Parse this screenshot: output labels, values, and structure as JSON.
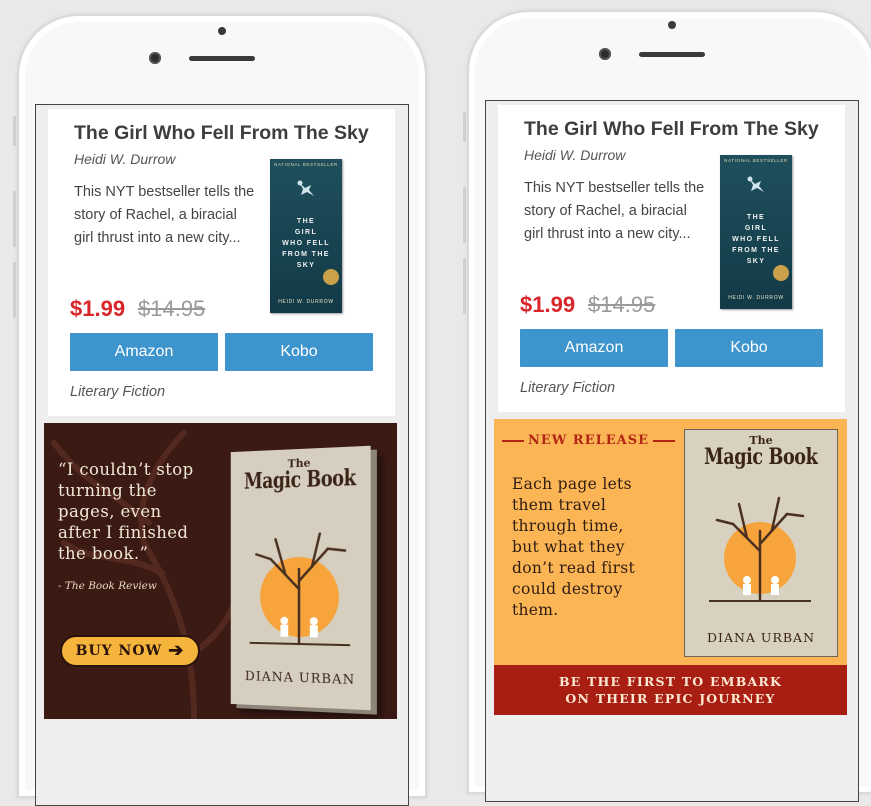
{
  "book": {
    "title": "The Girl Who Fell From The Sky",
    "author": "Heidi W. Durrow",
    "blurb": "This NYT bestseller tells the story of Rachel, a biracial girl thrust into a new city...",
    "sale_price": "$1.99",
    "original_price": "$14.95",
    "buttons": {
      "amazon": "Amazon",
      "kobo": "Kobo"
    },
    "genre": "Literary Fiction",
    "cover": {
      "badge": "NATIONAL BESTSELLER",
      "title_lines": [
        "THE",
        "GIRL",
        "WHO FELL",
        "FROM THE",
        "SKY"
      ],
      "author": "HEIDI W. DURROW"
    }
  },
  "ad_left": {
    "quote_lines": [
      "“I couldn’t stop",
      "turning the",
      "pages, even",
      "after I finished",
      "the book.”"
    ],
    "source": "- The Book Review",
    "buy_label": "BUY NOW",
    "book": {
      "the": "The",
      "name": "Magic Book",
      "author": "DIANA URBAN"
    }
  },
  "ad_right": {
    "tag": "NEW RELEASE",
    "desc_lines": [
      "Each page lets",
      "them travel",
      "through time,",
      "but what they",
      "don’t read first",
      "could destroy",
      "them."
    ],
    "banner_lines": [
      "BE THE FIRST TO EMBARK",
      "ON THEIR EPIC JOURNEY"
    ],
    "book": {
      "the": "The",
      "name": "Magic Book",
      "author": "DIANA URBAN"
    }
  },
  "colors": {
    "price_red": "#d8262b",
    "button_blue": "#3e95cd",
    "ad_dark_bg": "#3b1a14",
    "ad_light_bg": "#fbb555",
    "banner_red": "#a81e12"
  }
}
